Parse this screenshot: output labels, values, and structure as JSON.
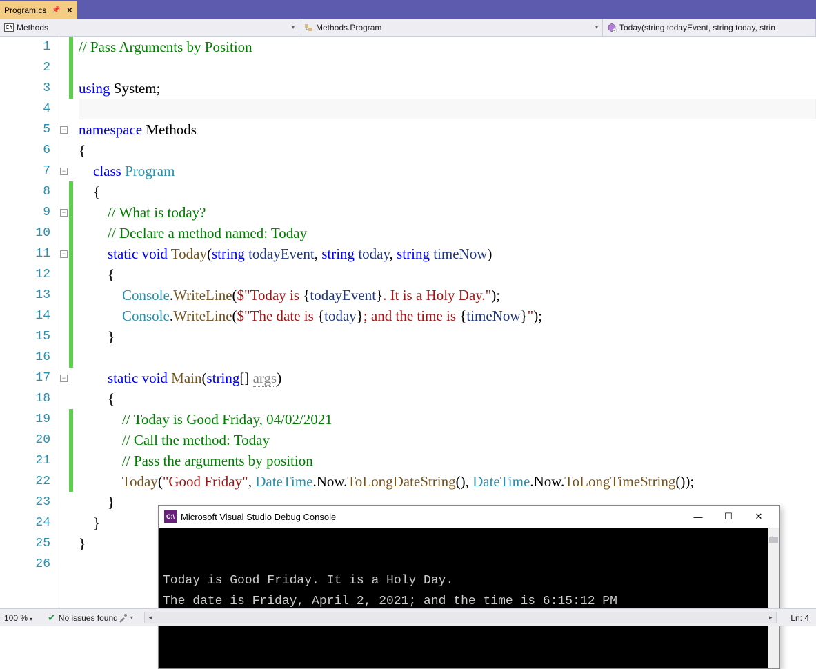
{
  "tab": {
    "filename": "Program.cs"
  },
  "nav": {
    "scope": "Methods",
    "class": "Methods.Program",
    "member": "Today(string todayEvent, string today, strin"
  },
  "code": {
    "lines": [
      {
        "n": 1,
        "change": true,
        "html": "<span class='c-comment'>// Pass Arguments by Position</span>"
      },
      {
        "n": 2,
        "change": true,
        "html": ""
      },
      {
        "n": 3,
        "change": true,
        "html": "<span class='c-key'>using</span> <span class='c-ident'>System;</span>"
      },
      {
        "n": 4,
        "change": false,
        "cur": true,
        "html": ""
      },
      {
        "n": 5,
        "change": false,
        "fold": "-",
        "html": "<span class='c-key'>namespace</span> <span class='c-ident'>Methods</span>"
      },
      {
        "n": 6,
        "change": false,
        "html": "{"
      },
      {
        "n": 7,
        "change": false,
        "fold": "-",
        "indent": 1,
        "html": "    <span class='c-key'>class</span> <span class='c-type'>Program</span>"
      },
      {
        "n": 8,
        "change": true,
        "html": "    {"
      },
      {
        "n": 9,
        "change": true,
        "fold": "-",
        "html": "        <span class='c-comment'>// What is today?</span>"
      },
      {
        "n": 10,
        "change": true,
        "html": "        <span class='c-comment'>// Declare a method named: Today</span>"
      },
      {
        "n": 11,
        "change": true,
        "fold": "-",
        "html": "        <span class='c-key'>static</span> <span class='c-key'>void</span> <span class='c-meth'>Today</span>(<span class='c-key'>string</span> <span class='c-param'>todayEvent</span>, <span class='c-key'>string</span> <span class='c-param'>today</span>, <span class='c-key'>string</span> <span class='c-param'>timeNow</span>)"
      },
      {
        "n": 12,
        "change": true,
        "html": "        {"
      },
      {
        "n": 13,
        "change": true,
        "html": "            <span class='c-type'>Console</span>.<span class='c-meth'>WriteLine</span>(<span class='c-str'>$\"Today is </span>{<span class='c-param'>todayEvent</span>}<span class='c-str'>. It is a Holy Day.\"</span>);"
      },
      {
        "n": 14,
        "change": true,
        "html": "            <span class='c-type'>Console</span>.<span class='c-meth'>WriteLine</span>(<span class='c-str'>$\"The date is </span>{<span class='c-param'>today</span>}<span class='c-str'>; and the time is </span>{<span class='c-param'>timeNow</span>}<span class='c-str'>\"</span>);"
      },
      {
        "n": 15,
        "change": true,
        "html": "        }"
      },
      {
        "n": 16,
        "change": true,
        "html": ""
      },
      {
        "n": 17,
        "change": false,
        "fold": "-",
        "html": "        <span class='c-key'>static</span> <span class='c-key'>void</span> <span class='c-meth'>Main</span>(<span class='c-key'>string</span>[] <span class='c-fade'>args</span>)"
      },
      {
        "n": 18,
        "change": false,
        "html": "        {"
      },
      {
        "n": 19,
        "change": true,
        "html": "            <span class='c-comment'>// Today is Good Friday, 04/02/2021</span>"
      },
      {
        "n": 20,
        "change": true,
        "html": "            <span class='c-comment'>// Call the method: Today</span>"
      },
      {
        "n": 21,
        "change": true,
        "html": "            <span class='c-comment'>// Pass the arguments by position</span>"
      },
      {
        "n": 22,
        "change": true,
        "html": "            <span class='c-meth'>Today</span>(<span class='c-str'>\"Good Friday\"</span>, <span class='c-type'>DateTime</span>.Now.<span class='c-meth'>ToLongDateString</span>(), <span class='c-type'>DateTime</span>.Now.<span class='c-meth'>ToLongTimeString</span>());"
      },
      {
        "n": 23,
        "change": false,
        "html": "        }"
      },
      {
        "n": 24,
        "change": false,
        "html": "    }"
      },
      {
        "n": 25,
        "change": false,
        "html": "}"
      },
      {
        "n": 26,
        "change": false,
        "html": ""
      }
    ]
  },
  "console": {
    "title": "Microsoft Visual Studio Debug Console",
    "lines": [
      "Today is Good Friday. It is a Holy Day.",
      "The date is Friday, April 2, 2021; and the time is 6:15:12 PM"
    ]
  },
  "status": {
    "zoom": "100 %",
    "issues": "No issues found",
    "position": "Ln: 4"
  }
}
